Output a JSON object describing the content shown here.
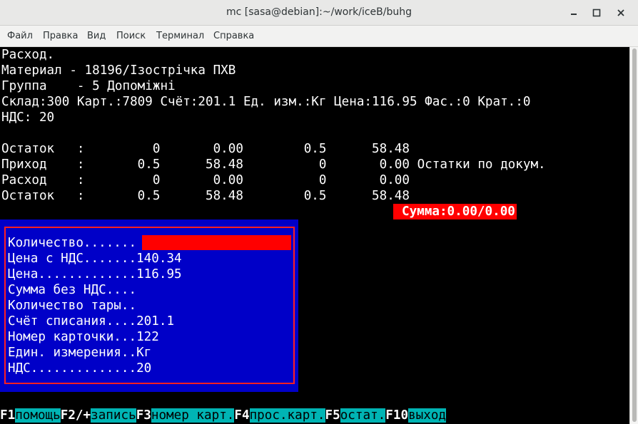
{
  "window": {
    "title": "mc [sasa@debian]:~/work/iceB/buhg"
  },
  "menu": [
    "Файл",
    "Правка",
    "Вид",
    "Поиск",
    "Терминал",
    "Справка"
  ],
  "header_lines": [
    "Расход.",
    "Материал - 18196/Ізострічка ПХВ",
    "Группа    - 5 Допоміжні",
    "Склад:300 Карт.:7809 Счёт:201.1 Ед. изм.:Кг Цена:116.95 Фас.:0 Крат.:0",
    "НДС: 20"
  ],
  "balance_rows": [
    "Остаток   :         0       0.00        0.5      58.48",
    "Приход    :       0.5      58.48          0       0.00 Остатки по докум.",
    "Расход    :         0       0.00          0       0.00",
    "Остаток   :       0.5      58.48        0.5      58.48"
  ],
  "summa": "Сумма:0.00/0.00",
  "form": [
    {
      "label": "Количество.......",
      "value": ""
    },
    {
      "label": "Цена с НДС.......",
      "value": "140.34"
    },
    {
      "label": "Цена.............",
      "value": "116.95"
    },
    {
      "label": "Сумма без НДС....",
      "value": ""
    },
    {
      "label": "Количество тары..",
      "value": ""
    },
    {
      "label": "Счёт списания....",
      "value": "201.1"
    },
    {
      "label": "Номер карточки...",
      "value": "122"
    },
    {
      "label": "Един. измерения..",
      "value": "Кг"
    },
    {
      "label": "НДС..............",
      "value": "20"
    }
  ],
  "fkeys": [
    {
      "key": "F1",
      "label": "помощь"
    },
    {
      "key": "F2/+",
      "label": "запись"
    },
    {
      "key": "F3",
      "label": "номер карт."
    },
    {
      "key": "F4",
      "label": "прос.карт."
    },
    {
      "key": "F5",
      "label": "остат."
    },
    {
      "key": "F10",
      "label": "выход"
    }
  ],
  "colors": {
    "terminal_bg": "#000000",
    "dialog_bg": "#0000c8",
    "dialog_border": "#ff2020",
    "highlight_red": "#ff0000",
    "fkey_label_bg": "#00b4b4"
  }
}
